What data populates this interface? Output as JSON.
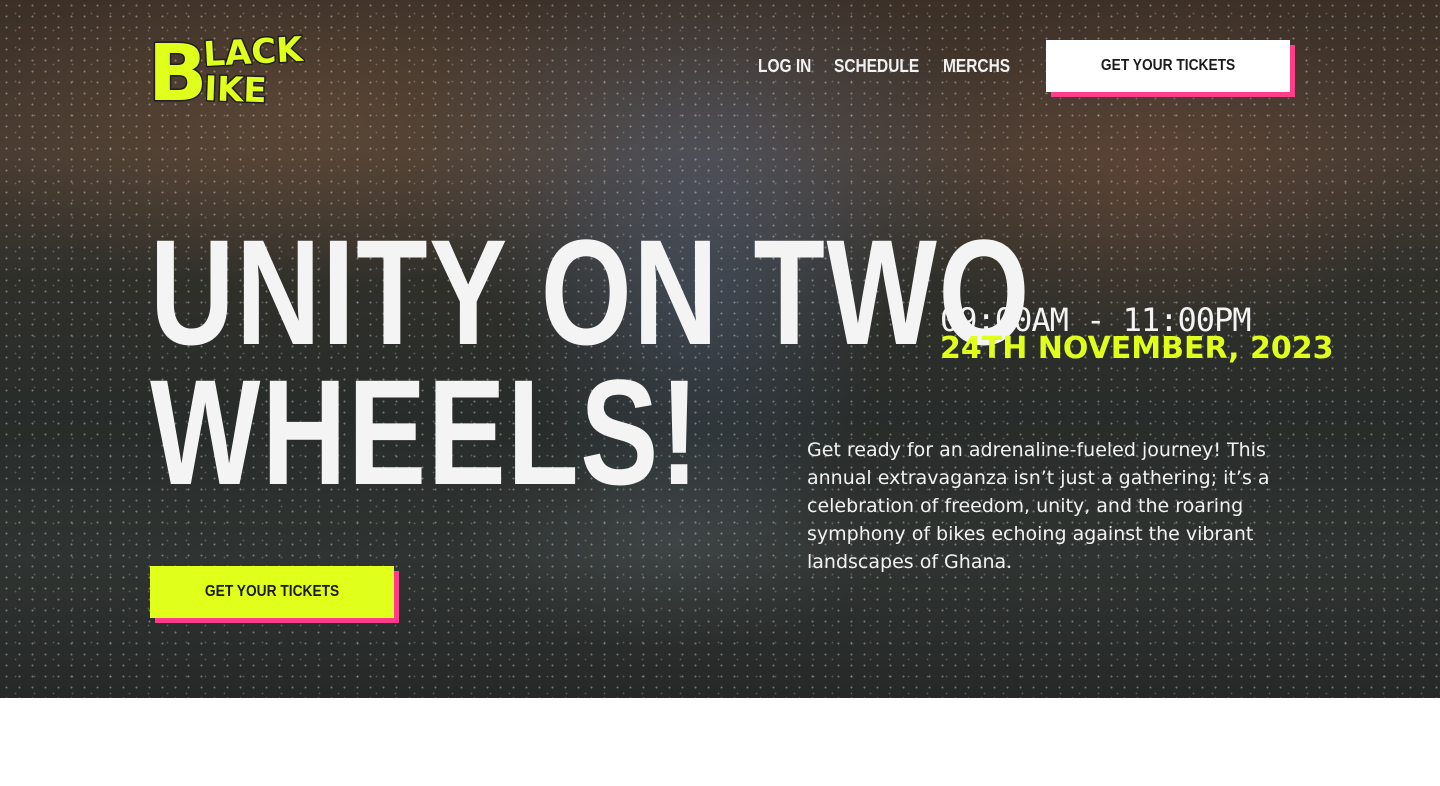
{
  "brand": {
    "logo_text": "BLACK BIKE",
    "logo_color": "#e0ff1a"
  },
  "nav": {
    "items": [
      "LOG IN",
      "SCHEDULE",
      "MERCHS"
    ]
  },
  "header_cta": {
    "label": "GET YOUR TICKETS"
  },
  "hero": {
    "headline_line1": "UNITY ON TWO",
    "headline_line2": "WHEELS!",
    "time": "09:00AM - 11:00PM",
    "date": "24TH NOVEMBER, 2023",
    "description": "Get ready for an adrenaline-fueled journey! This annual extravaganza isn’t just a gathering; it’s a celebration of freedom, unity, and the roaring symphony of bikes echoing against the vibrant landscapes of Ghana.",
    "cta_label": "GET YOUR TICKETS"
  },
  "colors": {
    "accent": "#e0ff1a",
    "shadow_pink": "#ff3d8b",
    "text_light": "#f4f4f4"
  }
}
